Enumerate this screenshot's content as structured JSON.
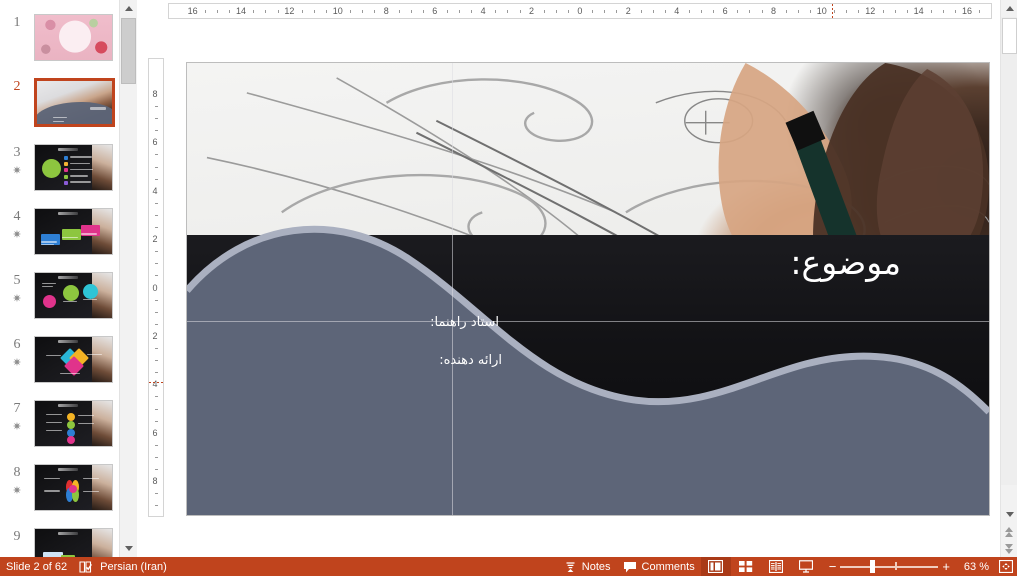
{
  "app": {
    "name": "PowerPoint Normal View"
  },
  "slide_pane": {
    "thumbnails": [
      {
        "number": "1",
        "animated": false,
        "kind": "title-floral",
        "selected": false
      },
      {
        "number": "2",
        "animated": false,
        "kind": "designer-photo",
        "selected": true
      },
      {
        "number": "3",
        "animated": true,
        "kind": "green-circle-list",
        "selected": false
      },
      {
        "number": "4",
        "animated": true,
        "kind": "colored-blocks",
        "selected": false
      },
      {
        "number": "5",
        "animated": true,
        "kind": "pie-charts",
        "selected": false
      },
      {
        "number": "6",
        "animated": true,
        "kind": "cmyk-cube",
        "selected": false
      },
      {
        "number": "7",
        "animated": true,
        "kind": "dot-list",
        "selected": false
      },
      {
        "number": "8",
        "animated": true,
        "kind": "color-pinwheel",
        "selected": false
      },
      {
        "number": "9",
        "animated": false,
        "kind": "chart-slide",
        "selected": false
      }
    ],
    "animation_star_glyph": "✷"
  },
  "rulers": {
    "horizontal_labels": [
      "16",
      "14",
      "12",
      "10",
      "8",
      "6",
      "4",
      "2",
      "0",
      "2",
      "4",
      "6",
      "8",
      "10",
      "12",
      "14",
      "16"
    ],
    "vertical_labels": [
      "8",
      "6",
      "4",
      "2",
      "0",
      "2",
      "4",
      "6",
      "8"
    ],
    "units": "cm"
  },
  "slide": {
    "subject_label": "موضوع:",
    "supervisor_label": "استاد راهنما:",
    "presenter_label": "ارائه دهنده:",
    "image_description": "industrial designer sketching with pen and french curve templates",
    "wave_color": "#5d6578",
    "wave_border_color": "#aab0c0",
    "background_color": "#0b0b0d"
  },
  "status_bar": {
    "slide_count_text": "Slide 2 of 62",
    "proofing_icon": "proofing-icon",
    "language": "Persian (Iran)",
    "notes_label": "Notes",
    "comments_label": "Comments",
    "views": [
      {
        "name": "normal-view",
        "label": "Normal",
        "active": true
      },
      {
        "name": "slide-sorter-view",
        "label": "Slide Sorter",
        "active": false
      },
      {
        "name": "reading-view",
        "label": "Reading View",
        "active": false
      },
      {
        "name": "slide-show-view",
        "label": "Slide Show",
        "active": false
      }
    ],
    "zoom_out_label": "−",
    "zoom_in_label": "+",
    "zoom_level": "63 %",
    "fit_label": "Fit slide to current window",
    "accent_color": "#c0441d"
  },
  "scrollbars": {
    "previous_slide_label": "Previous Slide",
    "next_slide_label": "Next Slide"
  }
}
